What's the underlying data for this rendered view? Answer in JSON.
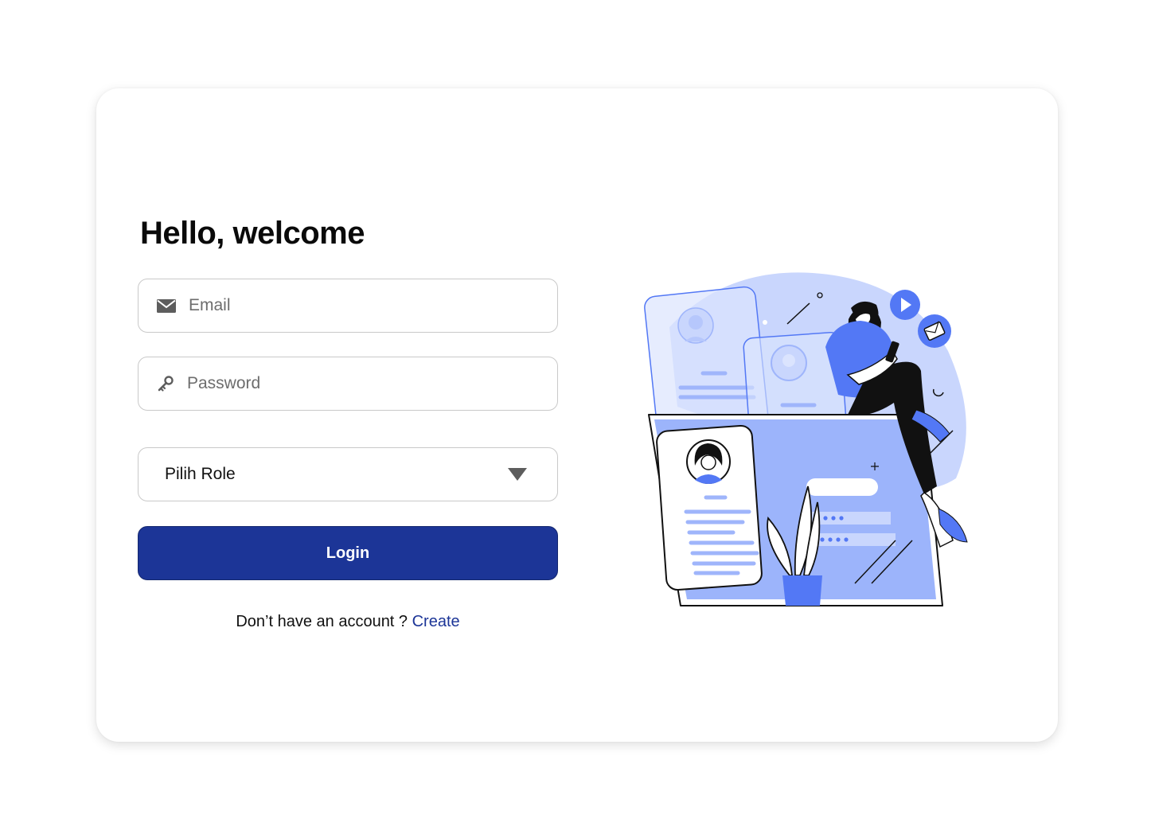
{
  "login": {
    "title": "Hello, welcome",
    "email_placeholder": "Email",
    "password_placeholder": "Password",
    "role_label": "Pilih Role",
    "login_label": "Login",
    "signup_prompt": "Don’t have an account ?",
    "signup_link": "Create"
  },
  "colors": {
    "primary": "#1c3597",
    "illustration_blue": "#5378f5",
    "illustration_light": "#c9d6fd"
  },
  "icons": {
    "email": "mail-icon",
    "password": "key-icon",
    "role": "caret-down-icon"
  }
}
